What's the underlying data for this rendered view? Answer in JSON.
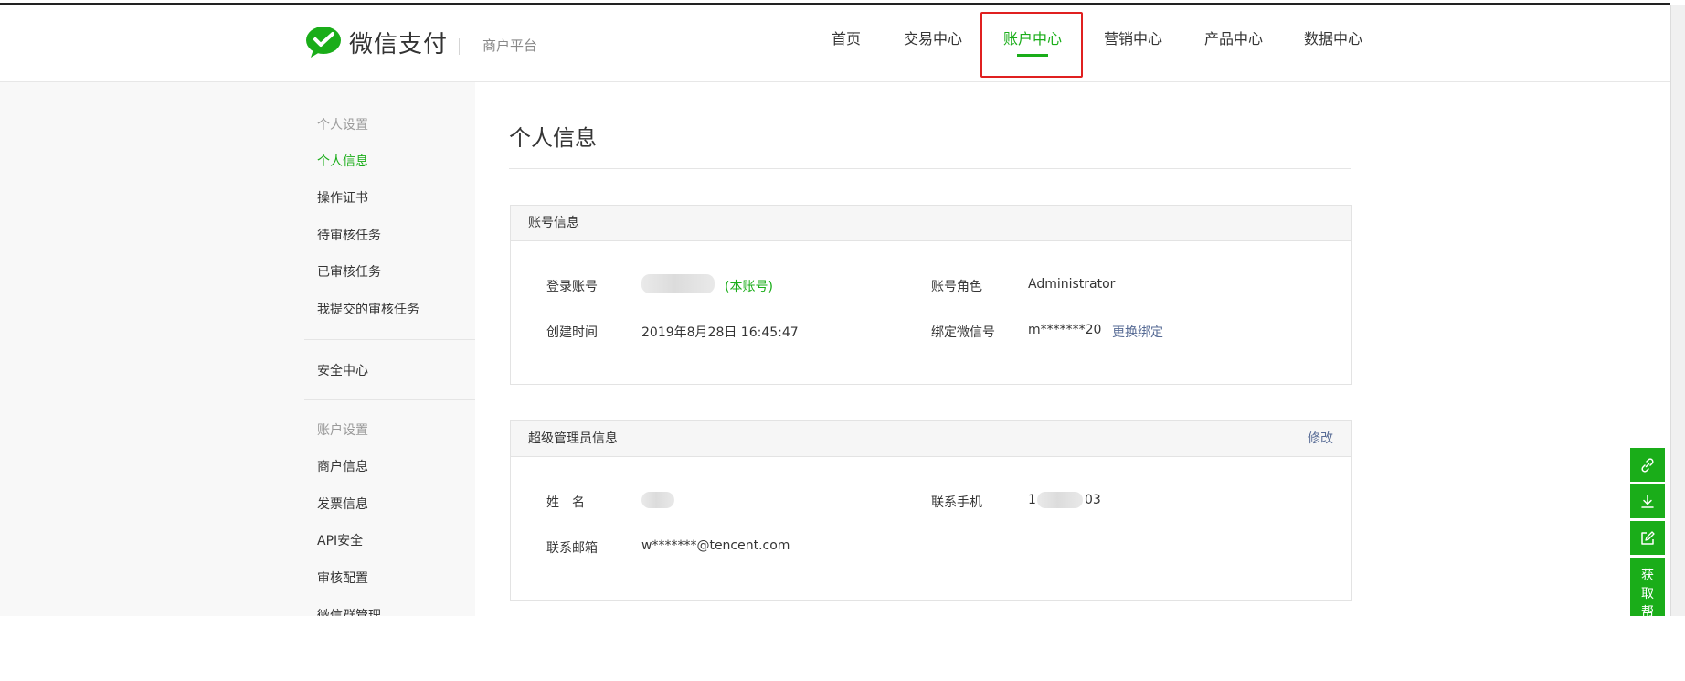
{
  "brand": {
    "name": "微信支付",
    "subtitle": "商户平台"
  },
  "colors": {
    "accent": "#1aad19",
    "link": "#576b95",
    "highlight_border": "#e02020"
  },
  "topnav": {
    "items": [
      {
        "label": "首页"
      },
      {
        "label": "交易中心"
      },
      {
        "label": "账户中心",
        "active": true
      },
      {
        "label": "营销中心"
      },
      {
        "label": "产品中心"
      },
      {
        "label": "数据中心"
      }
    ]
  },
  "sidebar": {
    "group_personal": "个人设置",
    "items_personal": [
      {
        "label": "个人信息",
        "active": true
      },
      {
        "label": "操作证书"
      },
      {
        "label": "待审核任务"
      },
      {
        "label": "已审核任务"
      },
      {
        "label": "我提交的审核任务"
      }
    ],
    "security": "安全中心",
    "group_account": "账户设置",
    "items_account": [
      {
        "label": "商户信息"
      },
      {
        "label": "发票信息"
      },
      {
        "label": "API安全"
      },
      {
        "label": "审核配置"
      },
      {
        "label": "微信群管理"
      }
    ]
  },
  "main": {
    "title": "个人信息",
    "account_panel": {
      "heading": "账号信息",
      "login_label": "登录账号",
      "login_note": "(本账号)",
      "role_label": "账号角色",
      "role_value": "Administrator",
      "created_label": "创建时间",
      "created_value": "2019年8月28日 16:45:47",
      "wechat_label": "绑定微信号",
      "wechat_value": "m*******20",
      "wechat_action": "更换绑定"
    },
    "admin_panel": {
      "heading": "超级管理员信息",
      "action": "修改",
      "name_label": "姓　名",
      "phone_label": "联系手机",
      "phone_prefix": "1",
      "phone_suffix": "03",
      "email_label": "联系邮箱",
      "email_value": "w*******@tencent.com"
    }
  },
  "floatbar": {
    "icons": [
      "link-icon",
      "download-icon",
      "edit-icon"
    ],
    "help_label": "获取帮"
  }
}
